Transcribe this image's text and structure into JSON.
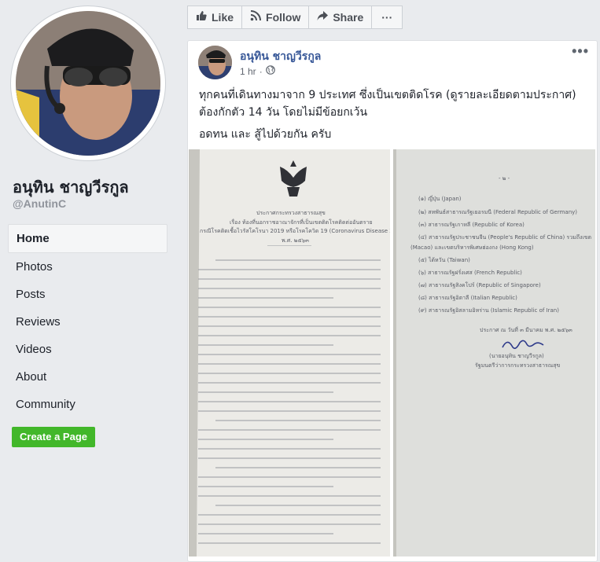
{
  "sidebar": {
    "page_name": "อนุทิน ชาญวีรกูล",
    "handle": "@AnutinC",
    "nav": [
      {
        "label": "Home",
        "active": true
      },
      {
        "label": "Photos"
      },
      {
        "label": "Posts"
      },
      {
        "label": "Reviews"
      },
      {
        "label": "Videos"
      },
      {
        "label": "About"
      },
      {
        "label": "Community"
      }
    ],
    "create_page": "Create a Page",
    "create_color": "#42b72a"
  },
  "toolbar": {
    "like": "Like",
    "follow": "Follow",
    "share": "Share",
    "more": "···"
  },
  "post": {
    "author": "อนุทิน ชาญวีรกูล",
    "time": "1 hr",
    "time_sep": "·",
    "menu": "•••",
    "text_line1": "ทุกคนที่เดินทางมาจาก 9 ประเทศ ซึ่งเป็นเขตติดโรค (ดูรายละเอียดตามประกาศ)",
    "text_line2": "ต้องกักตัว 14 วัน โดยไม่มีข้อยกเว้น",
    "text_line3": "อดทน และ สู้ไปด้วยกัน ครับ",
    "link_color": "#385898"
  },
  "doc1": {
    "header": "ประกาศกระทรวงสาธารณสุข",
    "subject": "เรื่อง ท้องที่นอกราชอาณาจักรที่เป็นเขตติดโรคติดต่ออันตราย",
    "subject2": "กรณีโรคติดเชื้อไวรัสโคโรนา 2019 หรือโรคโควิด 19 (Coronavirus Disease 2019 (COVID-19))",
    "date": "พ.ศ. ๒๕๖๓"
  },
  "doc2": {
    "page": "- ๒ -",
    "items": [
      "(๑) ญี่ปุ่น (Japan)",
      "(๒) สหพันธ์สาธารณรัฐเยอรมนี (Federal Republic of Germany)",
      "(๓) สาธารณรัฐเกาหลี (Republic of Korea)",
      "(๔) สาธารณรัฐประชาชนจีน (People's Republic of China) รวมถึงเขต",
      "(Macao) และเขตบริหารพิเศษฮ่องกง (Hong Kong)",
      "(๕) ไต้หวัน (Taiwan)",
      "(๖) สาธารณรัฐฝรั่งเศส (French Republic)",
      "(๗) สาธารณรัฐสิงคโปร์ (Republic of Singapore)",
      "(๘) สาธารณรัฐอิตาลี (Italian Republic)",
      "(๙) สาธารณรัฐอิสลามอิหร่าน (Islamic Republic of Iran)"
    ],
    "given": "ประกาศ ณ วันที่ ๓ มีนาคม พ.ศ. ๒๕๖๓",
    "signer": "(นายอนุทิน ชาญวีรกูล)",
    "signer_title": "รัฐมนตรีว่าการกระทรวงสาธารณสุข"
  }
}
